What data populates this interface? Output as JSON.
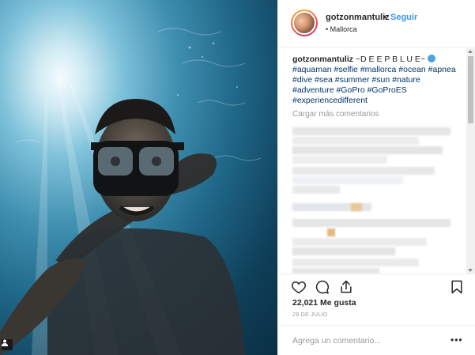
{
  "post": {
    "username": "gotzonmantuliz",
    "separator": "•",
    "follow_label": "Seguir",
    "location_prefix": "•",
    "location": "Mallorca"
  },
  "caption": {
    "user": "gotzonmantuliz",
    "text": "~D E E P B L U E~",
    "hashtags": [
      "#aquaman",
      "#selfie",
      "#mallorca",
      "#ocean",
      "#apnea",
      "#dive",
      "#sea",
      "#summer",
      "#sun",
      "#nature",
      "#adventure",
      "#GoPro",
      "#GoProES",
      "#experiencedifferent"
    ]
  },
  "comments": {
    "load_more_label": "Cargar más comentarios"
  },
  "actions": {
    "icons": [
      "heart-icon",
      "comment-icon",
      "share-icon",
      "bookmark-icon"
    ]
  },
  "likes_label": "22,021 Me gusta",
  "date_label": "29 DE JULIO",
  "add_comment": {
    "placeholder": "Agrega un comentario...",
    "more_label": "•••"
  },
  "colors": {
    "link": "#3897f0",
    "hashtag": "#003569",
    "muted": "#999999",
    "text": "#262626"
  }
}
